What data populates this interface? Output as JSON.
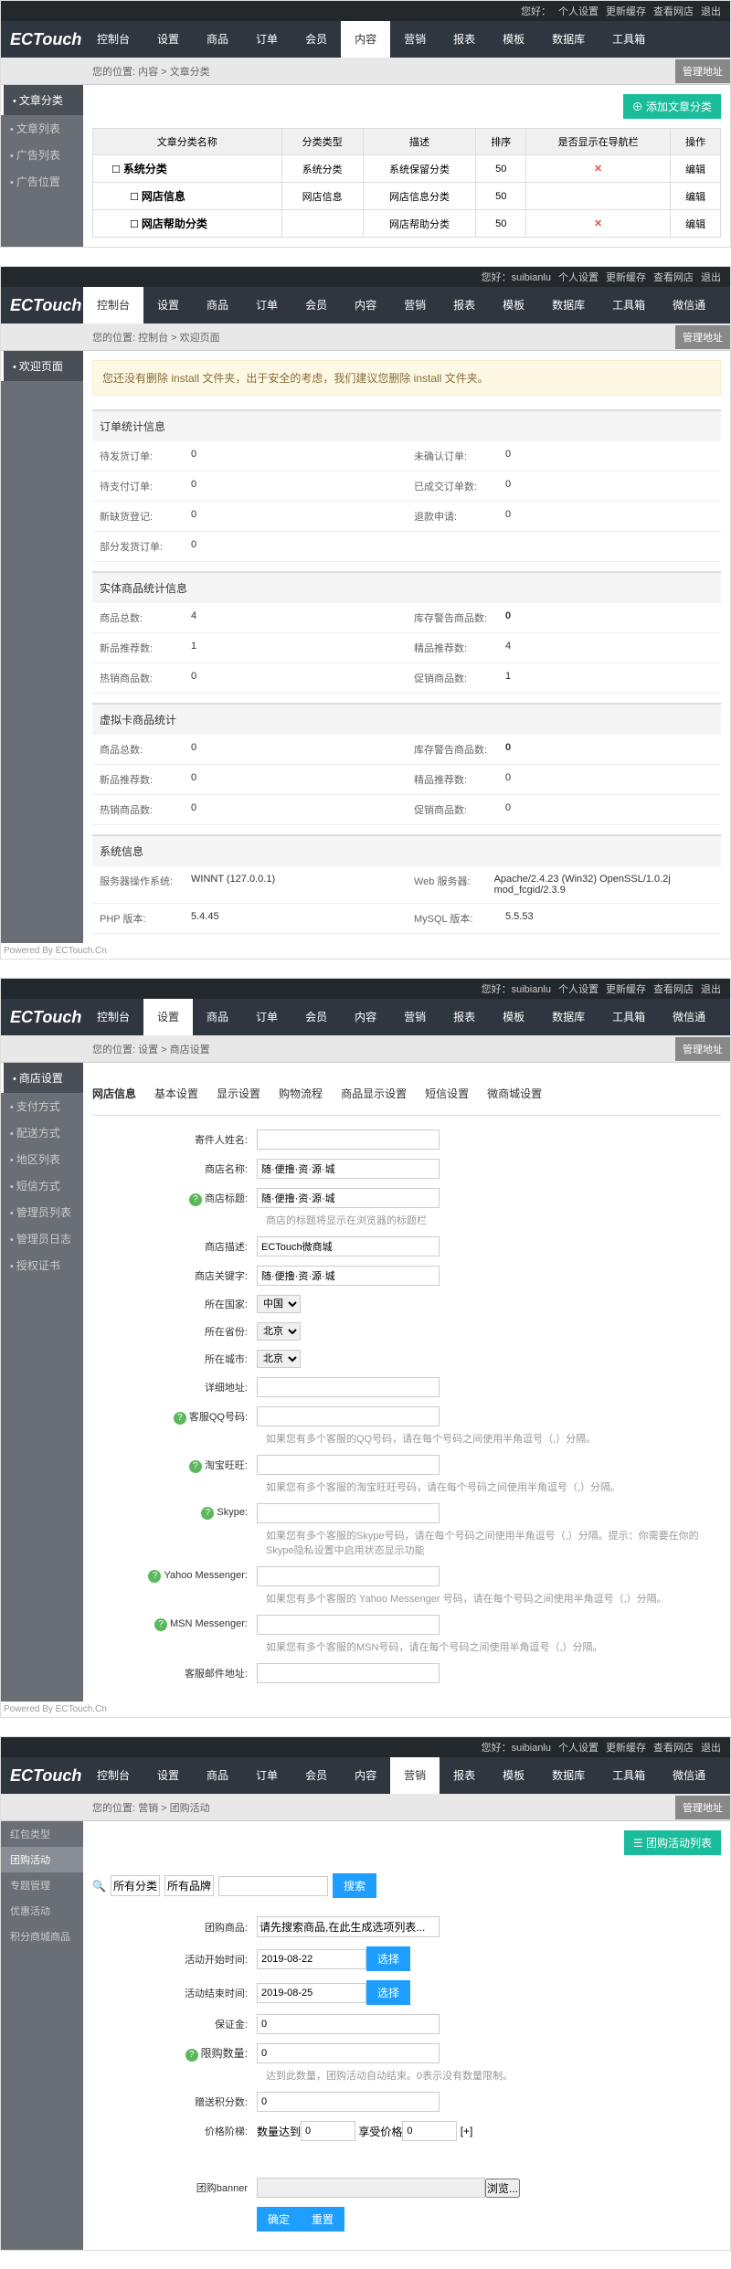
{
  "topbar": {
    "greeting1": "您好：",
    "greeting2": "您好：suibianlu",
    "links": [
      "个人设置",
      "更新缓存",
      "查看网店",
      "退出"
    ]
  },
  "logo": "ECTouch",
  "nav": [
    "控制台",
    "设置",
    "商品",
    "订单",
    "会员",
    "内容",
    "营销",
    "报表",
    "模板",
    "数据库",
    "工具箱",
    "微信通"
  ],
  "admin_btn": "管理地址",
  "shot1": {
    "active_nav": "内容",
    "breadcrumb": "您的位置: 内容 > 文章分类",
    "side_head": "文章分类",
    "side_items": [
      "文章列表",
      "广告列表",
      "广告位置"
    ],
    "add_btn": "添加文章分类",
    "headers": [
      "文章分类名称",
      "分类类型",
      "描述",
      "排序",
      "是否显示在导航栏",
      "操作"
    ],
    "rows": [
      {
        "name": "系统分类",
        "type": "系统分类",
        "desc": "系统保留分类",
        "sort": "50",
        "nav": "✕",
        "op": "编辑"
      },
      {
        "name": "网店信息",
        "type": "网店信息",
        "desc": "网店信息分类",
        "sort": "50",
        "nav": "",
        "op": "编辑"
      },
      {
        "name": "网店帮助分类",
        "type": "",
        "desc": "网店帮助分类",
        "sort": "50",
        "nav": "✕",
        "op": "编辑"
      }
    ]
  },
  "shot2": {
    "active_nav": "控制台",
    "breadcrumb": "您的位置: 控制台 > 欢迎页面",
    "side_head": "欢迎页面",
    "warning": "您还没有删除 install 文件夹，出于安全的考虑，我们建议您删除 install 文件夹。",
    "sec1": "订单统计信息",
    "sec1_rows": [
      {
        "l1": "待发货订单:",
        "v1": "0",
        "l2": "未确认订单:",
        "v2": "0"
      },
      {
        "l1": "待支付订单:",
        "v1": "0",
        "l2": "已成交订单数:",
        "v2": "0"
      },
      {
        "l1": "新缺货登记:",
        "v1": "0",
        "l2": "退款申请:",
        "v2": "0"
      },
      {
        "l1": "部分发货订单:",
        "v1": "0",
        "l2": "",
        "v2": ""
      }
    ],
    "sec2": "实体商品统计信息",
    "sec2_rows": [
      {
        "l1": "商品总数:",
        "v1": "4",
        "l2": "库存警告商品数:",
        "v2": "0",
        "red2": true
      },
      {
        "l1": "新品推荐数:",
        "v1": "1",
        "l2": "精品推荐数:",
        "v2": "4"
      },
      {
        "l1": "热销商品数:",
        "v1": "0",
        "l2": "促销商品数:",
        "v2": "1"
      }
    ],
    "sec3": "虚拟卡商品统计",
    "sec3_rows": [
      {
        "l1": "商品总数:",
        "v1": "0",
        "l2": "库存警告商品数:",
        "v2": "0",
        "red2": true
      },
      {
        "l1": "新品推荐数:",
        "v1": "0",
        "l2": "精品推荐数:",
        "v2": "0"
      },
      {
        "l1": "热销商品数:",
        "v1": "0",
        "l2": "促销商品数:",
        "v2": "0"
      }
    ],
    "sec4": "系统信息",
    "sec4_rows": [
      {
        "l1": "服务器操作系统:",
        "v1": "WINNT (127.0.0.1)",
        "l2": "Web 服务器:",
        "v2": "Apache/2.4.23 (Win32) OpenSSL/1.0.2j mod_fcgid/2.3.9"
      },
      {
        "l1": "PHP 版本:",
        "v1": "5.4.45",
        "l2": "MySQL 版本:",
        "v2": "5.5.53"
      }
    ],
    "credit": "Powered By ECTouch.Cn"
  },
  "shot3": {
    "active_nav": "设置",
    "breadcrumb": "您的位置: 设置 > 商店设置",
    "side_head": "商店设置",
    "side_items": [
      "支付方式",
      "配送方式",
      "地区列表",
      "短信方式",
      "管理员列表",
      "管理员日志",
      "授权证书"
    ],
    "tabs": [
      "网店信息",
      "基本设置",
      "显示设置",
      "购物流程",
      "商品显示设置",
      "短信设置",
      "微商城设置"
    ],
    "form": {
      "f1": {
        "label": "寄件人姓名:",
        "value": ""
      },
      "f2": {
        "label": "商店名称:",
        "value": "随·便撸·资·源·城"
      },
      "f3": {
        "label": "商店标题:",
        "value": "随·便撸·资·源·城",
        "help": true,
        "hint": "商店的标题将显示在浏览器的标题栏"
      },
      "f4": {
        "label": "商店描述:",
        "value": "ECTouch微商城"
      },
      "f5": {
        "label": "商店关键字:",
        "value": "随·便撸·资·源·城"
      },
      "f6": {
        "label": "所在国家:",
        "value": "中国"
      },
      "f7": {
        "label": "所在省份:",
        "value": "北京"
      },
      "f8": {
        "label": "所在城市:",
        "value": "北京"
      },
      "f9": {
        "label": "详细地址:",
        "value": ""
      },
      "f10": {
        "label": "客服QQ号码:",
        "value": "",
        "help": true,
        "hint": "如果您有多个客服的QQ号码，请在每个号码之间使用半角逗号（,）分隔。"
      },
      "f11": {
        "label": "淘宝旺旺:",
        "value": "",
        "help": true,
        "hint": "如果您有多个客服的淘宝旺旺号码，请在每个号码之间使用半角逗号（,）分隔。"
      },
      "f12": {
        "label": "Skype:",
        "value": "",
        "help": true,
        "hint": "如果您有多个客服的Skype号码，请在每个号码之间使用半角逗号（,）分隔。提示：你需要在你的Skype隐私设置中启用状态显示功能"
      },
      "f13": {
        "label": "Yahoo Messenger:",
        "value": "",
        "help": true,
        "hint": "如果您有多个客服的 Yahoo Messenger 号码，请在每个号码之间使用半角逗号（,）分隔。"
      },
      "f14": {
        "label": "MSN Messenger:",
        "value": "",
        "help": true,
        "hint": "如果您有多个客服的MSN号码，请在每个号码之间使用半角逗号（,）分隔。"
      },
      "f15": {
        "label": "客服邮件地址:",
        "value": ""
      }
    },
    "credit": "Powered By ECTouch.Cn"
  },
  "shot4": {
    "active_nav": "营销",
    "breadcrumb": "您的位置: 营销 > 团购活动",
    "side_items": [
      "红包类型",
      "团购活动",
      "专题管理",
      "优惠活动",
      "积分商城商品"
    ],
    "list_btn": "团购活动列表",
    "search": {
      "all_cat": "所有分类",
      "all_brand": "所有品牌",
      "btn": "搜索"
    },
    "form": {
      "f1": {
        "label": "团购商品:",
        "value": "请先搜索商品,在此生成选项列表..."
      },
      "f2": {
        "label": "活动开始时间:",
        "value": "2019-08-22",
        "btn": "选择"
      },
      "f3": {
        "label": "活动结束时间:",
        "value": "2019-08-25",
        "btn": "选择"
      },
      "f4": {
        "label": "保证金:",
        "value": "0"
      },
      "f5": {
        "label": "限购数量:",
        "value": "0",
        "help": true,
        "hint": "达到此数量，团购活动自动结束。0表示没有数量限制。"
      },
      "f6": {
        "label": "赠送积分数:",
        "value": "0"
      },
      "f7": {
        "label": "价格阶梯:",
        "qty_label": "数量达到",
        "qty": "0",
        "price_label": "享受价格",
        "price": "0",
        "add": "[+]"
      },
      "f8": {
        "label": "团购banner",
        "browse": "浏览..."
      },
      "submit": "确定",
      "reset": "重置"
    }
  }
}
